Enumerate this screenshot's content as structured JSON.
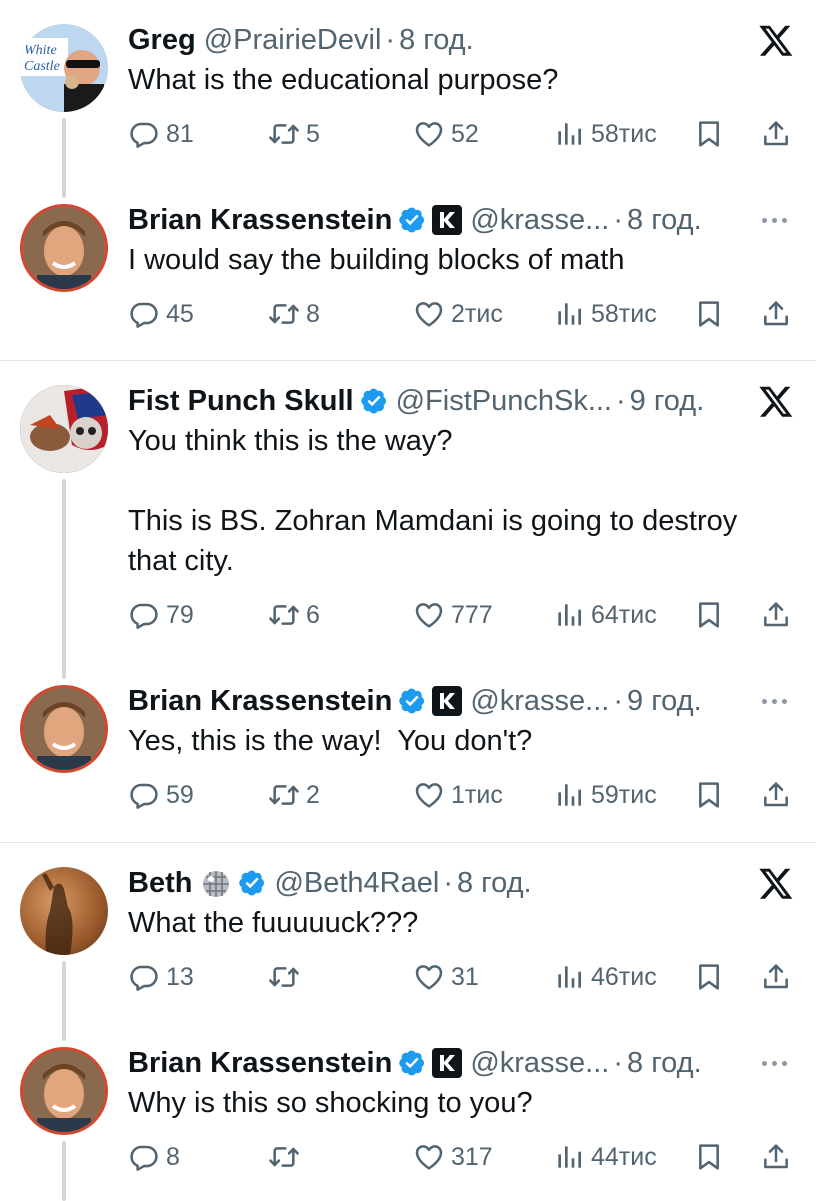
{
  "tweets": [
    {
      "name": "Greg",
      "handle": "@PrairieDevil",
      "dot": "·",
      "time": "8 год.",
      "text": "What is the educational purpose?",
      "replies": "81",
      "retweets": "5",
      "likes": "52",
      "views": "58тис",
      "avatar_text": "White Castle"
    },
    {
      "name": "Brian Krassenstein",
      "handle": "@krasse...",
      "dot": "·",
      "time": "8 год.",
      "text": "I would say the building blocks of math",
      "replies": "45",
      "retweets": "8",
      "likes": "2тис",
      "views": "58тис"
    },
    {
      "name": "Fist Punch Skull",
      "handle": "@FistPunchSk...",
      "dot": "·",
      "time": "9 год.",
      "text": "You think this is the way?\n\nThis is BS. Zohran Mamdani is going to destroy that city.",
      "replies": "79",
      "retweets": "6",
      "likes": "777",
      "views": "64тис"
    },
    {
      "name": "Brian Krassenstein",
      "handle": "@krasse...",
      "dot": "·",
      "time": "9 год.",
      "text": "Yes, this is the way!  You don't?",
      "replies": "59",
      "retweets": "2",
      "likes": "1тис",
      "views": "59тис"
    },
    {
      "name": "Beth",
      "handle": "@Beth4Rael",
      "dot": "·",
      "time": "8 год.",
      "text": "What the fuuuuuck???",
      "replies": "13",
      "retweets": "",
      "likes": "31",
      "views": "46тис"
    },
    {
      "name": "Brian Krassenstein",
      "handle": "@krasse...",
      "dot": "·",
      "time": "8 год.",
      "text": "Why is this so shocking to you?",
      "replies": "8",
      "retweets": "",
      "likes": "317",
      "views": "44тис"
    }
  ],
  "icons": {
    "reply": "reply-icon",
    "retweet": "retweet-icon",
    "like": "heart-icon",
    "views": "views-icon",
    "bookmark": "bookmark-icon",
    "share": "share-icon",
    "x_logo": "x-logo-icon",
    "more": "more-icon",
    "verified": "verified-badge-icon"
  },
  "colors": {
    "verified": "#1d9bf0",
    "secondary_text": "#536471",
    "divider": "#e1e6ea"
  }
}
